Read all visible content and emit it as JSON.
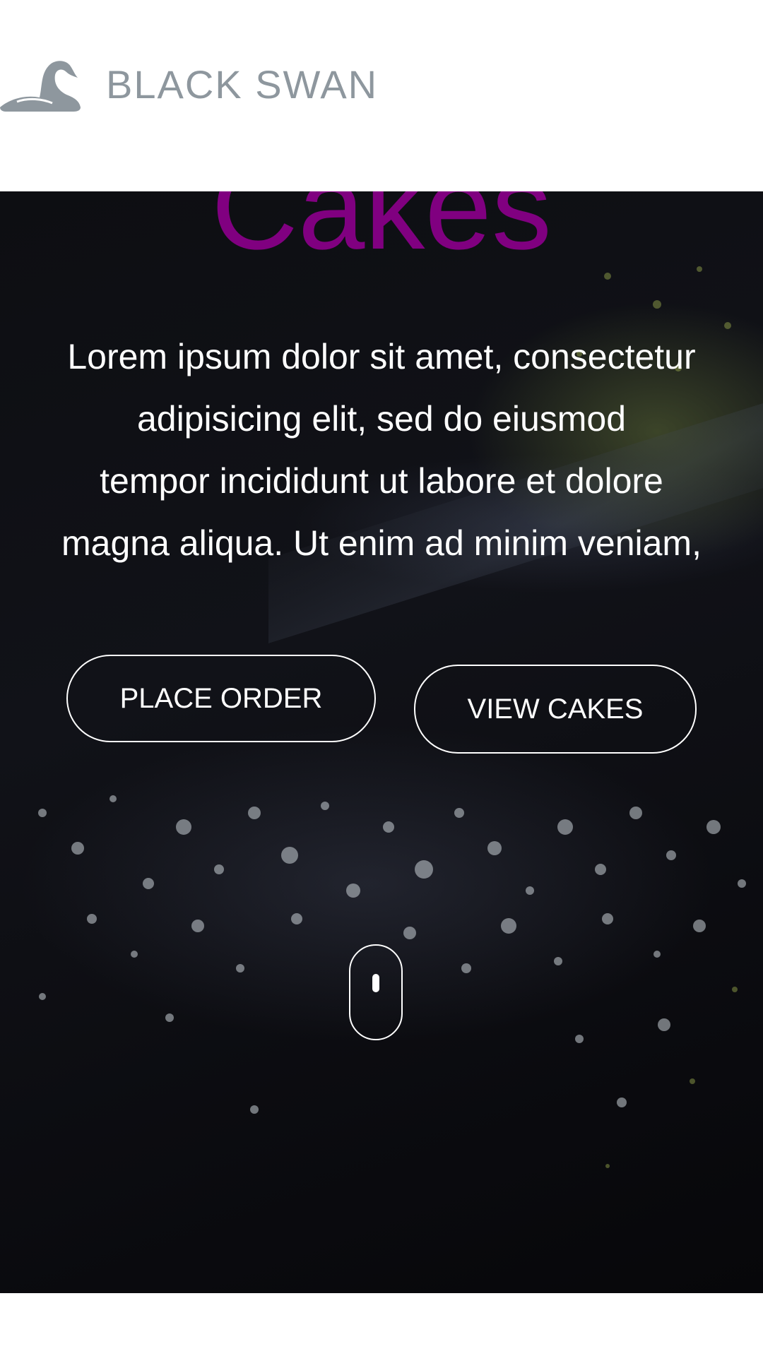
{
  "brand": {
    "name": "BLACK SWAN",
    "logo_icon": "swan-icon",
    "logo_color": "#8e979e"
  },
  "hero": {
    "heading": "Cakes",
    "heading_color": "#800080",
    "copy_lines": [
      "Lorem ipsum dolor sit amet, consectetur",
      "adipisicing elit, sed do eiusmod",
      "tempor incididunt ut labore et dolore",
      "magna aliqua. Ut enim ad minim veniam,"
    ],
    "buttons": {
      "place_order": "PLACE ORDER",
      "view_cakes": "VIEW CAKES"
    },
    "scroll_indicator_icon": "mouse-scroll-icon"
  },
  "colors": {
    "hero_background": "#0a0a0e",
    "text": "#ffffff",
    "page_background": "#ffffff"
  }
}
